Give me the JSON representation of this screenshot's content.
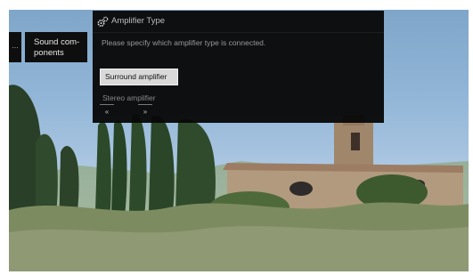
{
  "nav": {
    "stub_label": "...",
    "item_label": "Sound com-\nponents"
  },
  "dialog": {
    "title": "Amplifier Type",
    "prompt": "Please specify which amplifier type is connected.",
    "options": [
      "Surround amplifier",
      "Stereo amplifier"
    ],
    "selected_option": "Surround amplifier",
    "back_key": "«",
    "forward_key": "»"
  },
  "icons": {
    "dialog_icon": "gear-icon"
  }
}
